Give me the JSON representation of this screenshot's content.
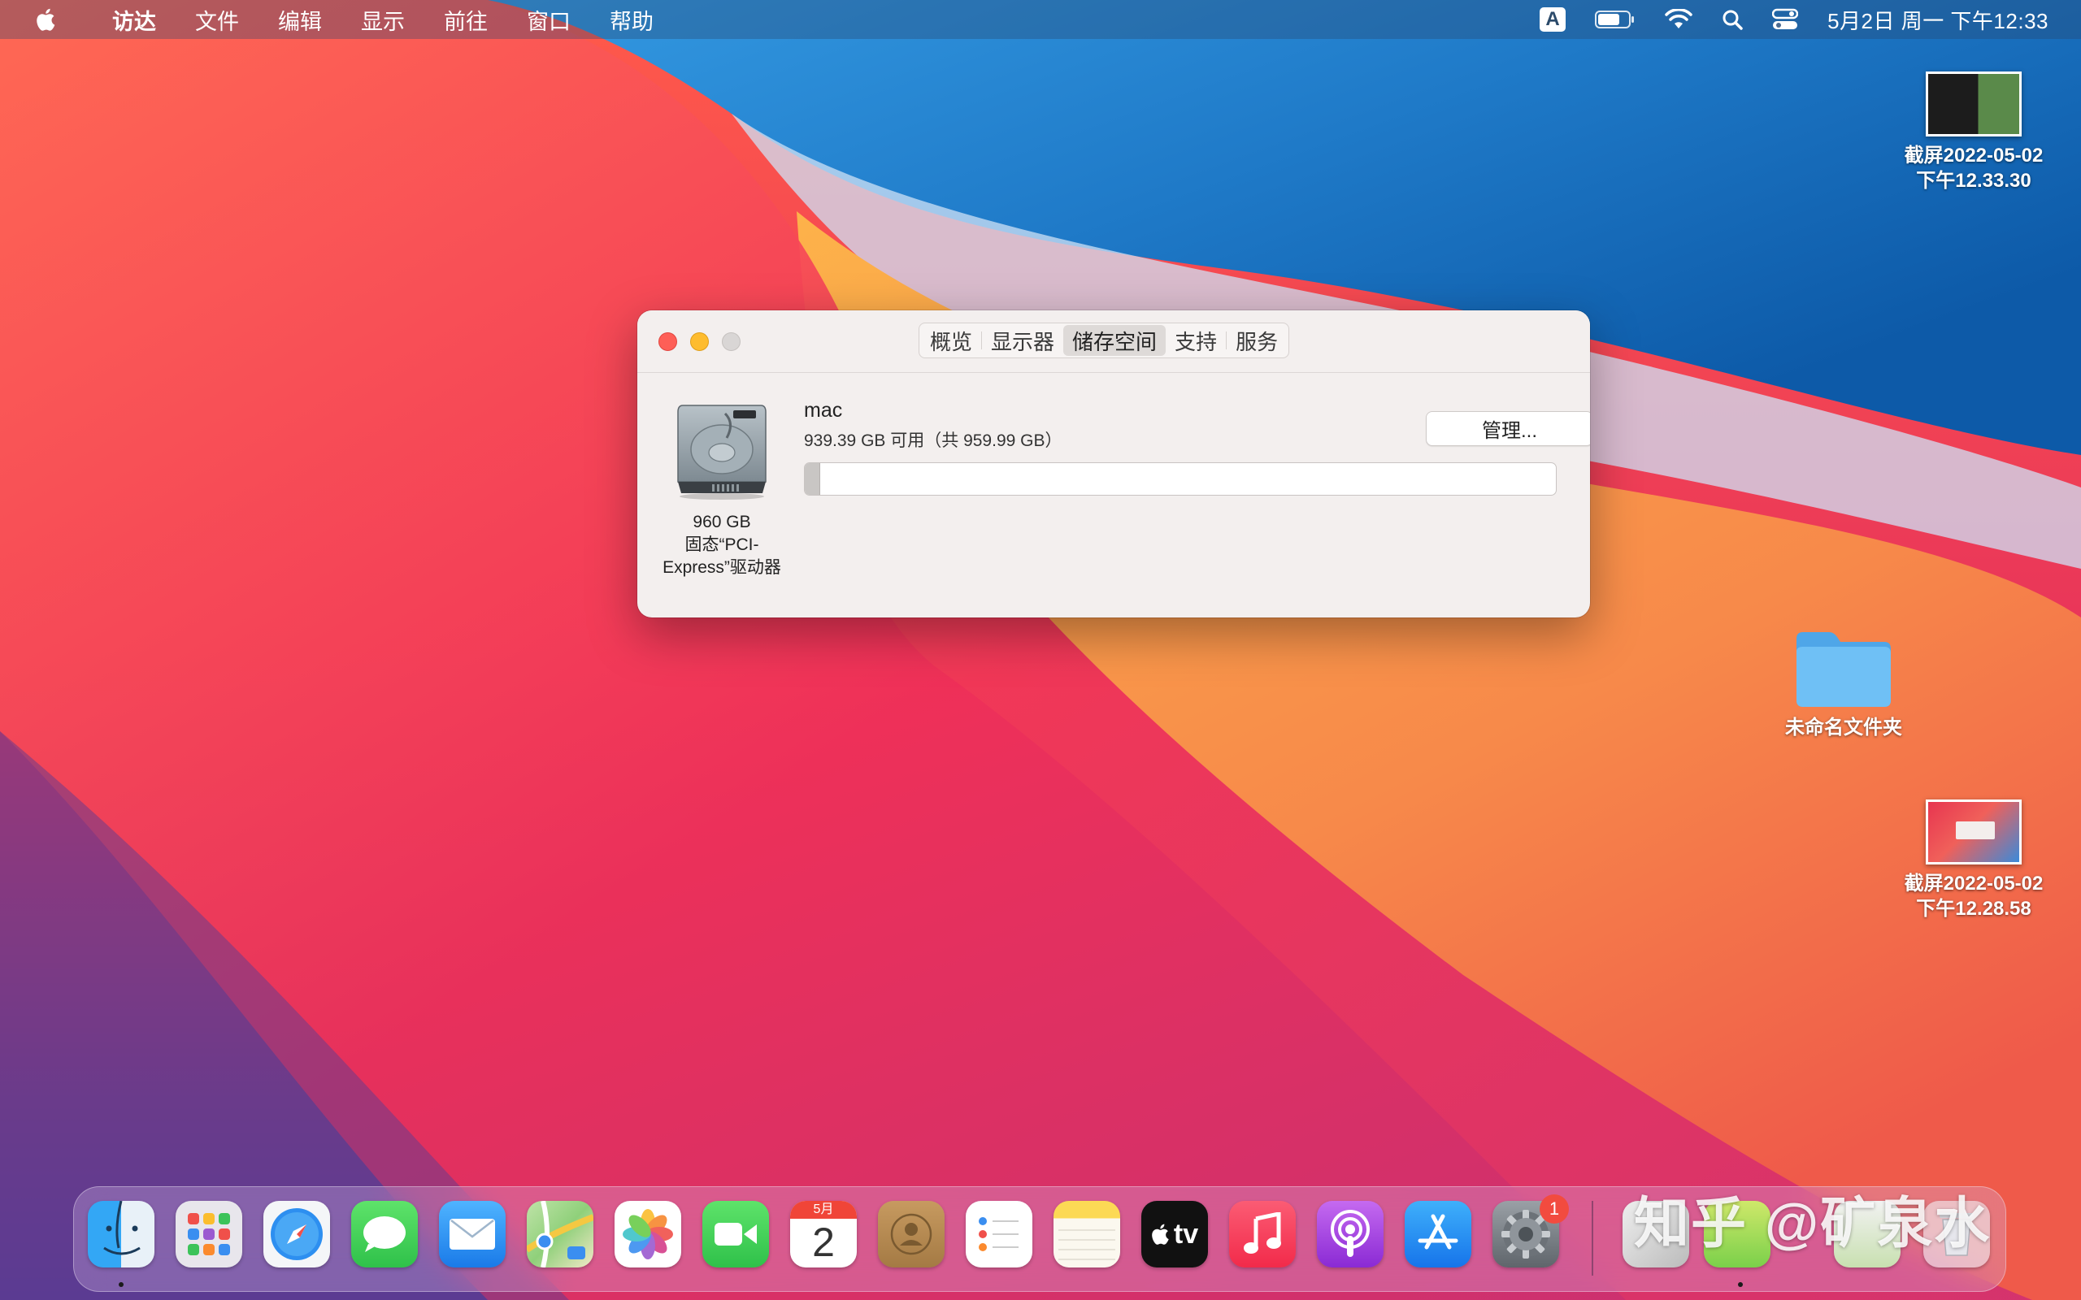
{
  "menubar": {
    "app_menus": [
      "访达",
      "文件",
      "编辑",
      "显示",
      "前往",
      "窗口",
      "帮助"
    ],
    "input_method": "A",
    "clock": "5月2日 周一 下午12:33"
  },
  "desktop": {
    "items": [
      {
        "label_line1": "截屏2022-05-02",
        "label_line2": "下午12.33.30"
      },
      {
        "label_line1": "未命名文件夹",
        "label_line2": ""
      },
      {
        "label_line1": "截屏2022-05-02",
        "label_line2": "下午12.28.58"
      }
    ]
  },
  "window": {
    "tabs": [
      "概览",
      "显示器",
      "储存空间",
      "支持",
      "服务"
    ],
    "active_tab": "储存空间",
    "drive": {
      "size": "960 GB",
      "type_line1": "固态“PCI-",
      "type_line2": "Express”驱动器"
    },
    "volume": {
      "name": "mac",
      "available": "939.39 GB 可用（共 959.99 GB）",
      "used_fraction": 0.021
    },
    "manage_button": "管理..."
  },
  "dock": {
    "apps": [
      "访达",
      "启动台",
      "Safari浏览器",
      "信息",
      "邮件",
      "地图",
      "照片",
      "FaceTime通话",
      "日历",
      "通讯录",
      "提醒事项",
      "备忘录",
      "视频",
      "音乐",
      "播客",
      "App Store",
      "系统偏好设置"
    ],
    "calendar_month": "5月",
    "calendar_day": "2",
    "tv_label": "tv",
    "settings_badge": "1"
  },
  "watermark": "知乎 @矿泉水"
}
